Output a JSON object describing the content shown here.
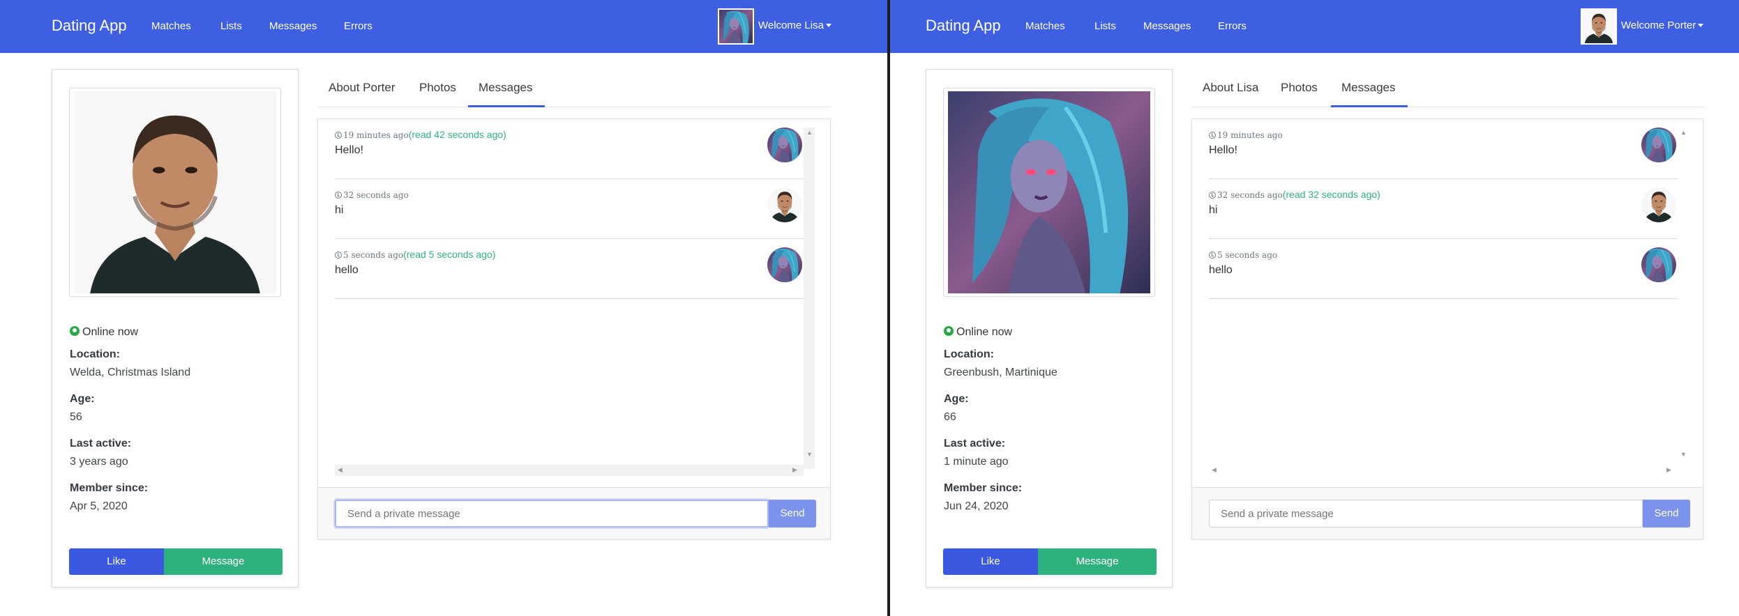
{
  "left": {
    "navbar": {
      "brand": "Dating App",
      "links": [
        "Matches",
        "Lists",
        "Messages",
        "Errors"
      ],
      "welcome": "Welcome Lisa"
    },
    "profile": {
      "online": "Online now",
      "location_label": "Location:",
      "location": "Welda, Christmas Island",
      "age_label": "Age:",
      "age": "56",
      "last_active_label": "Last active:",
      "last_active": "3 years ago",
      "member_since_label": "Member since:",
      "member_since": "Apr 5, 2020",
      "like_label": "Like",
      "message_label": "Message"
    },
    "tabs": [
      "About Porter",
      "Photos",
      "Messages"
    ],
    "active_tab": "Messages",
    "messages": [
      {
        "time": "19 minutes ago",
        "read": "(read 42 seconds ago)",
        "text": "Hello!",
        "sender": "lisa"
      },
      {
        "time": "32 seconds ago",
        "read": "",
        "text": "hi",
        "sender": "porter"
      },
      {
        "time": "5 seconds ago",
        "read": "(read 5 seconds ago)",
        "text": "hello",
        "sender": "lisa"
      }
    ],
    "input": {
      "placeholder": "Send a private message",
      "send_label": "Send"
    }
  },
  "right": {
    "navbar": {
      "brand": "Dating App",
      "links": [
        "Matches",
        "Lists",
        "Messages",
        "Errors"
      ],
      "welcome": "Welcome Porter"
    },
    "profile": {
      "online": "Online now",
      "location_label": "Location:",
      "location": "Greenbush, Martinique",
      "age_label": "Age:",
      "age": "66",
      "last_active_label": "Last active:",
      "last_active": "1 minute ago",
      "member_since_label": "Member since:",
      "member_since": "Jun 24, 2020",
      "like_label": "Like",
      "message_label": "Message"
    },
    "tabs": [
      "About Lisa",
      "Photos",
      "Messages"
    ],
    "active_tab": "Messages",
    "messages": [
      {
        "time": "19 minutes ago",
        "read": "",
        "text": "Hello!",
        "sender": "lisa"
      },
      {
        "time": "32 seconds ago",
        "read": "(read 32 seconds ago)",
        "text": "hi",
        "sender": "porter"
      },
      {
        "time": "5 seconds ago",
        "read": "",
        "text": "hello",
        "sender": "lisa"
      }
    ],
    "input": {
      "placeholder": "Send a private message",
      "send_label": "Send"
    }
  },
  "colors": {
    "navbar": "#3f5fe3",
    "like": "#3a59e0",
    "message": "#2eb27d",
    "read": "#2eb27d",
    "send": "#7b93ec"
  }
}
